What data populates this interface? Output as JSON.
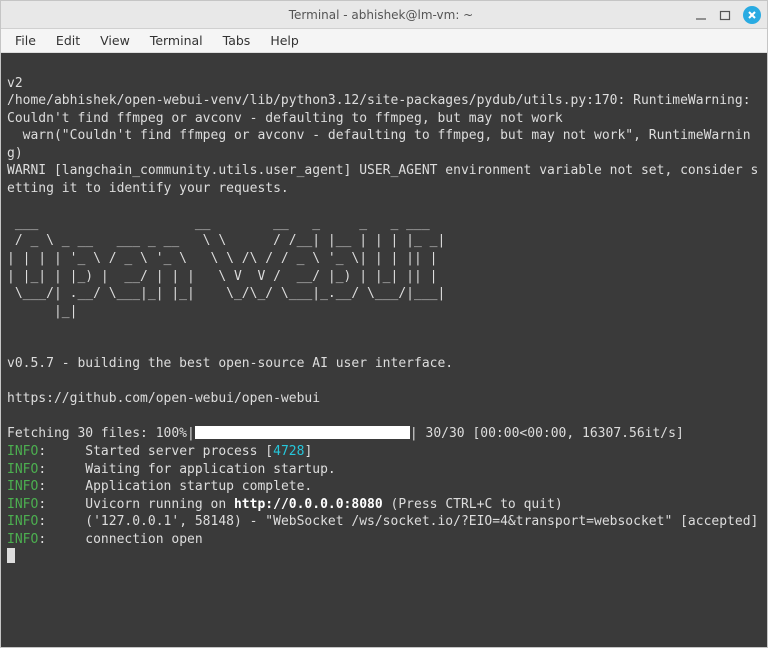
{
  "window": {
    "title": "Terminal - abhishek@lm-vm: ~"
  },
  "menu": [
    "File",
    "Edit",
    "View",
    "Terminal",
    "Tabs",
    "Help"
  ],
  "terminal": {
    "header_lines": [
      "v2",
      "/home/abhishek/open-webui-venv/lib/python3.12/site-packages/pydub/utils.py:170: RuntimeWarning: Couldn't find ffmpeg or avconv - defaulting to ffmpeg, but may not work",
      "  warn(\"Couldn't find ffmpeg or avconv - defaulting to ffmpeg, but may not work\", RuntimeWarning)",
      "WARNI [langchain_community.utils.user_agent] USER_AGENT environment variable not set, consider setting it to identify your requests."
    ],
    "ascii_art": " ___                    __        __   _     _   _ ___\n / _ \\ _ __   ___ _ __   \\ \\      / /__| |__ | | | |_ _|\n| | | | '_ \\ / _ \\ '_ \\   \\ \\ /\\ / / _ \\ '_ \\| | | || |\n| |_| | |_) |  __/ | | |   \\ V  V /  __/ |_) | |_| || |\n \\___/| .__/ \\___|_| |_|    \\_/\\_/ \\___|_.__/ \\___/|___|\n      |_|",
    "postlines": [
      "",
      "",
      "v0.5.7 - building the best open-source AI user interface.",
      "",
      "https://github.com/open-webui/open-webui",
      ""
    ],
    "fetch_prefix": "Fetching 30 files: 100%|",
    "fetch_suffix": "| 30/30 [00:00<00:00, 16307.56it/s]",
    "info1_label": "INFO",
    "info1_rest": ":     Started server process [",
    "pid": "4728",
    "info1_tail": "]",
    "info2_label": "INFO",
    "info2_rest": ":     Waiting for application startup.",
    "info3_label": "INFO",
    "info3_rest": ":     Application startup complete.",
    "info4_label": "INFO",
    "info4_pre": ":     Uvicorn running on ",
    "info4_bold": "http://0.0.0.0:8080",
    "info4_post": " (Press CTRL+C to quit)",
    "info5_label": "INFO",
    "info5_rest": ":     ('127.0.0.1', 58148) - \"WebSocket /ws/socket.io/?EIO=4&transport=websocket\" [accepted]",
    "info6_label": "INFO",
    "info6_rest": ":     connection open"
  }
}
